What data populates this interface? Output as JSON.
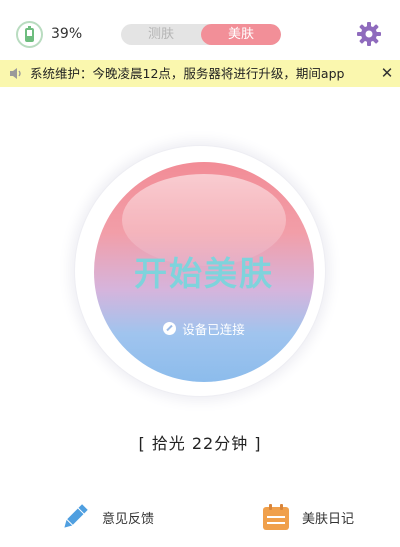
{
  "header": {
    "battery_percent": "39%",
    "battery_level": 0.39,
    "tabs": [
      {
        "label": "测肤",
        "active": false
      },
      {
        "label": "美肤",
        "active": true
      }
    ],
    "settings_icon": "gear-icon"
  },
  "notice": {
    "text": "系统维护：今晚凌晨12点，服务器将进行升级，期间app",
    "close_label": "✕",
    "icon": "speaker-icon"
  },
  "main": {
    "button_label": "开始美肤",
    "device_status": "设备已连接"
  },
  "status": {
    "text": "[ 拾光   22分钟 ]"
  },
  "bottom": {
    "feedback_label": "意见反馈",
    "diary_label": "美肤日记"
  },
  "colors": {
    "accent_pink": "#f28f98",
    "gear_purple": "#8f6bbd",
    "battery_green": "#6ebd7f",
    "notice_bg": "#faf7ae"
  }
}
